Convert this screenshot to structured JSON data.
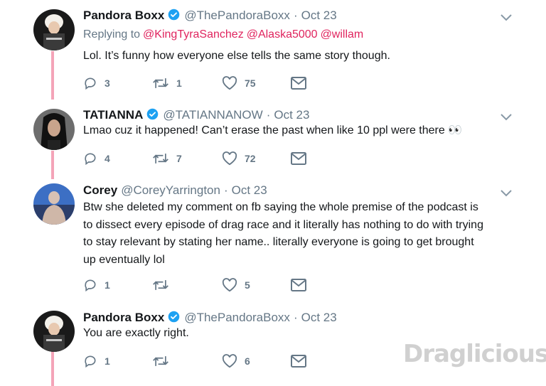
{
  "tweets": [
    {
      "name": "Pandora Boxx",
      "handle": "@ThePandoraBoxx",
      "date": "Oct 23",
      "verified": true,
      "replying_to_label": "Replying to",
      "replying_to": [
        "@KingTyraSanchez",
        "@Alaska5000",
        "@willam"
      ],
      "text": "Lol. It’s funny how everyone else tells the same story though.",
      "replies": "3",
      "retweets": "1",
      "likes": "75",
      "avatar_icon": "pandora-avatar"
    },
    {
      "name": "TATIANNA",
      "handle": "@TATIANNANOW",
      "date": "Oct 23",
      "verified": true,
      "text": "Lmao cuz it happened! Can’t erase the past when like 10 ppl were there 👀",
      "replies": "4",
      "retweets": "7",
      "likes": "72",
      "avatar_icon": "tatianna-avatar"
    },
    {
      "name": "Corey",
      "handle": "@CoreyYarrington",
      "date": "Oct 23",
      "verified": false,
      "text_lines": [
        "Btw she deleted my comment on fb saying the whole premise of the podcast is",
        "to dissect every episode of drag race and it literally has nothing to do with trying",
        "to stay relevant by stating her name.. literally everyone is going to get brought",
        "up eventually lol"
      ],
      "replies": "1",
      "retweets": "",
      "likes": "5",
      "avatar_icon": "corey-avatar"
    },
    {
      "name": "Pandora Boxx",
      "handle": "@ThePandoraBoxx",
      "date": "Oct 23",
      "verified": true,
      "text": "You are exactly right.",
      "replies": "1",
      "retweets": "",
      "likes": "6",
      "avatar_icon": "pandora-avatar"
    }
  ],
  "separator": "·",
  "watermark": "Draglicious",
  "colors": {
    "thread_line": "#f4a4b8",
    "mention": "#e0245e",
    "verified": "#1da1f2",
    "meta": "#657786"
  }
}
